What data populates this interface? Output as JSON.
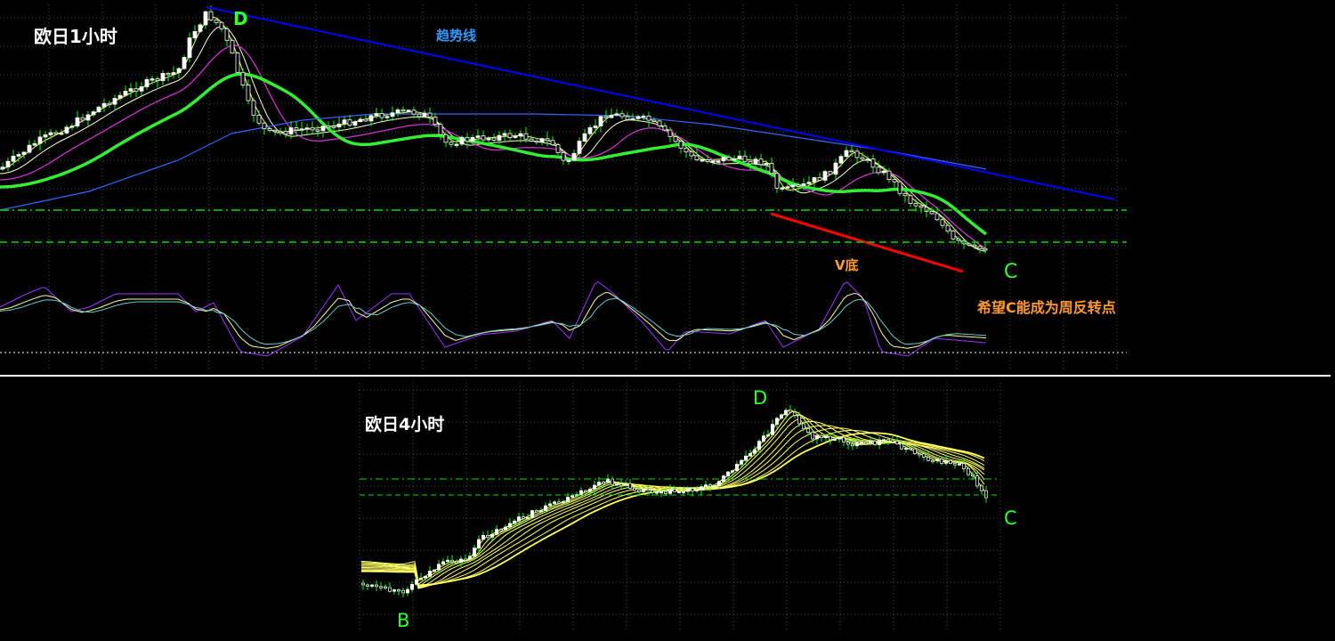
{
  "labels": {
    "top_title": "欧日1小时",
    "bottom_title": "欧日4小时",
    "trend_label": "趋势线",
    "v_bottom_label": "V底",
    "hope_label": "希望C能成为周反转点",
    "top_point_d": "D",
    "top_point_c": "C",
    "bottom_point_d": "D",
    "bottom_point_c": "C",
    "bottom_point_b": "B"
  },
  "colors": {
    "background": "#000000",
    "grid": "#4a4a4a",
    "candle": "#ffffff",
    "wick": "#00ff00",
    "trendline": "#0000ff",
    "red_line": "#ff0000",
    "level_line": "#00dd00",
    "ma_yellow": "#ffff66",
    "ma_magenta": "#cc33cc",
    "ma_green": "#33ee33",
    "ma_blue": "#3366ff",
    "osc_purple": "#9933ff",
    "osc_yellow": "#ffff99",
    "osc_cyan": "#66cccc",
    "label_green": "#33ff33",
    "label_orange": "#ff9933",
    "label_blue": "#3399ff",
    "label_white": "#ffffff"
  },
  "chart_data": [
    {
      "title": "欧日1小时",
      "type": "line",
      "note_series": [],
      "x": [
        0,
        10,
        20,
        30,
        40,
        50,
        60,
        70,
        80,
        90,
        100,
        110,
        120,
        130,
        140,
        150,
        160,
        170,
        180,
        190,
        200,
        210,
        220,
        230,
        240,
        250,
        260,
        270,
        280,
        290,
        300
      ],
      "series": [
        {
          "values": [
            40,
            42,
            45,
            49,
            53,
            55,
            57,
            59,
            62,
            66,
            74,
            70,
            60,
            49,
            47,
            46,
            46,
            45,
            47,
            45,
            46,
            43,
            44,
            44,
            41,
            42,
            38,
            37,
            33,
            30,
            28
          ]
        }
      ]
    },
    {
      "title": "欧日4小时",
      "type": "line",
      "x": [
        0,
        10,
        20,
        30,
        40,
        50,
        60,
        70,
        80,
        90,
        100,
        110,
        120,
        130,
        140,
        150,
        160,
        170,
        180,
        190,
        200
      ],
      "series": [
        {
          "values": [
            20,
            18,
            16,
            22,
            30,
            36,
            42,
            48,
            52,
            50,
            50,
            52,
            60,
            72,
            85,
            78,
            74,
            73,
            72,
            66,
            60
          ]
        }
      ]
    }
  ]
}
